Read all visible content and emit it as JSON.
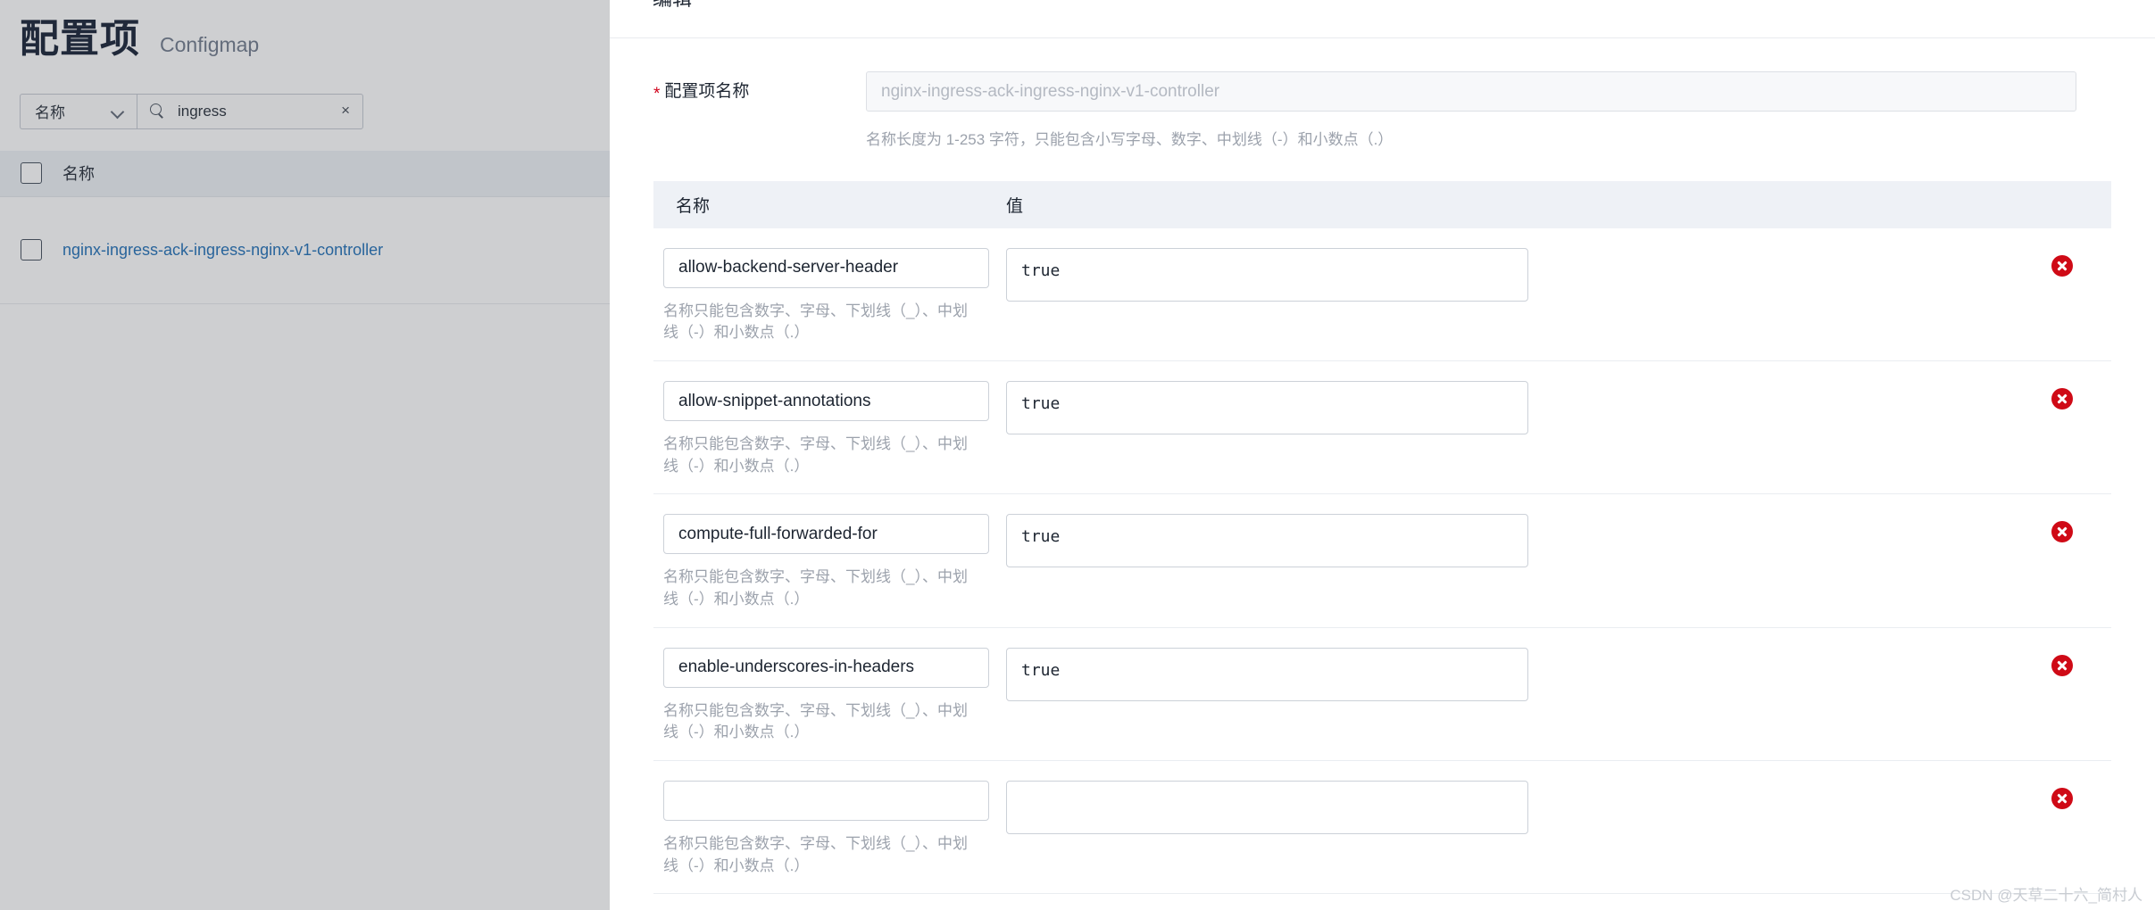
{
  "list_pane": {
    "title": "配置项",
    "subtitle": "Configmap",
    "filter": {
      "select_value": "名称",
      "select_icon": "chevron-down-icon",
      "search_icon": "search-icon",
      "search_value": "ingress",
      "clear_icon": "×"
    },
    "table": {
      "header": {
        "name": "名称"
      },
      "rows": [
        {
          "name": "nginx-ingress-ack-ingress-nginx-v1-controller"
        }
      ]
    }
  },
  "drawer": {
    "header_title": "编辑",
    "name_field": {
      "required_mark": "*",
      "label": "配置项名称",
      "placeholder": "nginx-ingress-ack-ingress-nginx-v1-controller",
      "hint": "名称长度为 1-253 字符，只能包含小写字母、数字、中划线（-）和小数点（.）"
    },
    "kv_table": {
      "header": {
        "name": "名称",
        "value": "值"
      },
      "name_hint": "名称只能包含数字、字母、下划线（_）、中划线（-）和小数点（.）",
      "delete_icon": "delete-circle-icon",
      "rows": [
        {
          "name": "allow-backend-server-header",
          "value": "true"
        },
        {
          "name": "allow-snippet-annotations",
          "value": "true"
        },
        {
          "name": "compute-full-forwarded-for",
          "value": "true"
        },
        {
          "name": "enable-underscores-in-headers",
          "value": "true"
        },
        {
          "name": "",
          "value": ""
        }
      ]
    }
  },
  "watermark": "CSDN @天草二十六_简村人",
  "colors": {
    "link": "#1a6bb5",
    "required": "#d0021b",
    "delete": "#cf0a16",
    "header_bg": "#eef1f6"
  }
}
